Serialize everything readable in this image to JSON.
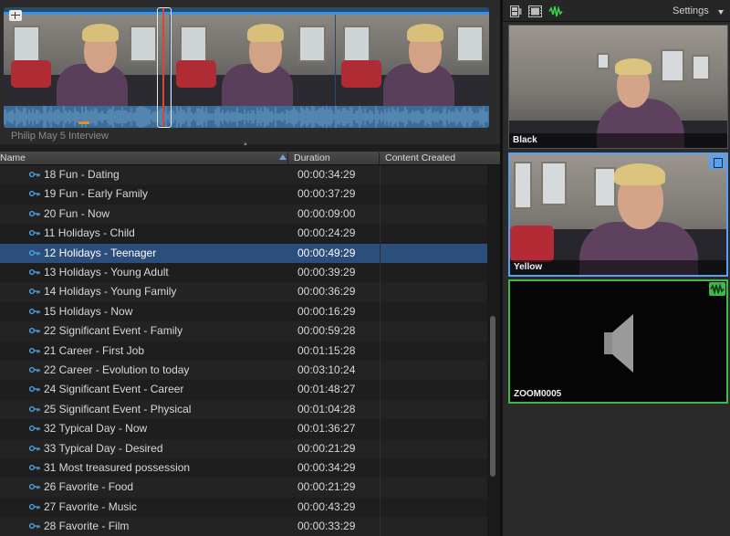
{
  "filmstrip": {
    "clip_title": "Philip May 5 Interview"
  },
  "list": {
    "columns": {
      "name": "Name",
      "duration": "Duration",
      "created": "Content Created"
    },
    "rows": [
      {
        "name": "18 Fun - Dating",
        "duration": "00:00:34:29",
        "selected": false
      },
      {
        "name": "19 Fun - Early Family",
        "duration": "00:00:37:29",
        "selected": false
      },
      {
        "name": "20 Fun - Now",
        "duration": "00:00:09:00",
        "selected": false
      },
      {
        "name": "11 Holidays - Child",
        "duration": "00:00:24:29",
        "selected": false
      },
      {
        "name": "12 Holidays - Teenager",
        "duration": "00:00:49:29",
        "selected": true
      },
      {
        "name": "13 Holidays - Young Adult",
        "duration": "00:00:39:29",
        "selected": false
      },
      {
        "name": "14 Holidays - Young Family",
        "duration": "00:00:36:29",
        "selected": false
      },
      {
        "name": "15 Holidays - Now",
        "duration": "00:00:16:29",
        "selected": false
      },
      {
        "name": "22 Significant Event - Family",
        "duration": "00:00:59:28",
        "selected": false
      },
      {
        "name": "21 Career - First Job",
        "duration": "00:01:15:28",
        "selected": false
      },
      {
        "name": "22 Career - Evolution to today",
        "duration": "00:03:10:24",
        "selected": false
      },
      {
        "name": "24 Significant Event - Career",
        "duration": "00:01:48:27",
        "selected": false
      },
      {
        "name": "25 Significant Event - Physical",
        "duration": "00:01:04:28",
        "selected": false
      },
      {
        "name": "32 Typical Day - Now",
        "duration": "00:01:36:27",
        "selected": false
      },
      {
        "name": "33 Typical Day - Desired",
        "duration": "00:00:21:29",
        "selected": false
      },
      {
        "name": "31 Most treasured possession",
        "duration": "00:00:34:29",
        "selected": false
      },
      {
        "name": "26 Favorite - Food",
        "duration": "00:00:21:29",
        "selected": false
      },
      {
        "name": "27 Favorite - Music",
        "duration": "00:00:43:29",
        "selected": false
      },
      {
        "name": "28 Favorite - Film",
        "duration": "00:00:33:29",
        "selected": false
      }
    ]
  },
  "angle_viewer": {
    "settings_label": "Settings",
    "angles": [
      {
        "label": "Black",
        "active": false
      },
      {
        "label": "Yellow",
        "active": true,
        "badge": "video"
      },
      {
        "label": "ZOOM0005",
        "active": true,
        "badge": "audio"
      }
    ],
    "colors": {
      "video_active": "#5aa0f0",
      "audio_active": "#3fb84a",
      "selection": "#2c4e7c",
      "playline": "#3b8fe6"
    }
  }
}
